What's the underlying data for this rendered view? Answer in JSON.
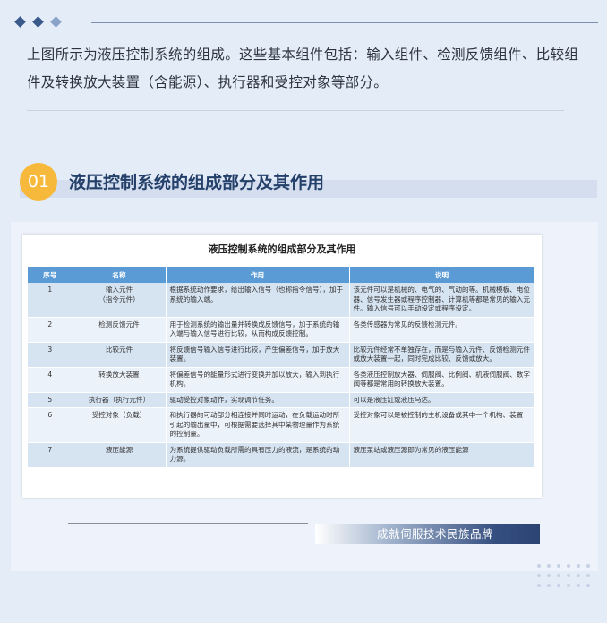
{
  "intro_text": "上图所示为液压控制系统的组成。这些基本组件包括：输入组件、检测反馈组件、比较组件及转换放大装置（含能源）、执行器和受控对象等部分。",
  "section": {
    "number": "01",
    "title": "液压控制系统的组成部分及其作用"
  },
  "table": {
    "title": "液压控制系统的组成部分及其作用",
    "headers": [
      "序号",
      "名称",
      "作用",
      "说明"
    ],
    "rows": [
      [
        "1",
        "输入元件\n（指令元件）",
        "根据系统动作要求，给出输入信号（也称指令信号），加于系统的输入端。",
        "该元件可以是机械的、电气的、气动的等。机械模板、电位器、信号发生器或程序控制器、计算机等都是常见的输入元件。输入信号可以手动设定或程序设定。"
      ],
      [
        "2",
        "检测反馈元件",
        "用于检测系统的输出量并转换成反馈信号，加于系统的输入端与输入信号进行比较，从而构成反馈控制。",
        "各类传感器为常见的反馈检测元件。"
      ],
      [
        "3",
        "比较元件",
        "将反馈信号输入信号进行比较，产生偏差信号，加于放大装置。",
        "比较元件经常不单独存在，而是与输入元件、反馈检测元件或放大装置一起，同时完成比较、反馈或放大。"
      ],
      [
        "4",
        "转换放大装置",
        "将偏差信号的能量形式进行变换并加以放大，输入到执行机构。",
        "各类液压控制放大器、伺服阀、比例阀、机液伺服阀、数字阀等都是常用的转换放大装置。"
      ],
      [
        "5",
        "执行器（执行元件）",
        "驱动受控对象动作，实现调节任务。",
        "可以是液压缸或液压马达。"
      ],
      [
        "6",
        "受控对象（负载）",
        "和执行器的可动部分相连接并同时运动，在负载运动时所引起的输出量中，可根据需要选择其中某物理量作为系统的控制量。",
        "受控对象可以是被控制的主机设备或其中一个机构、装置"
      ],
      [
        "7",
        "液压能源",
        "为系统提供驱动负载所需的具有压力的液流，是系统的动力源。",
        "液压泵站或液压源即为常见的液压能源"
      ]
    ]
  },
  "brand_text": "成就伺服技术民族品牌",
  "colors": {
    "accent_orange": "#f6b93b",
    "title_blue": "#24406a",
    "header_blue": "#5b9bd5",
    "diamond_dark": "#3a5a8c",
    "diamond_light": "#8aa4c8"
  }
}
